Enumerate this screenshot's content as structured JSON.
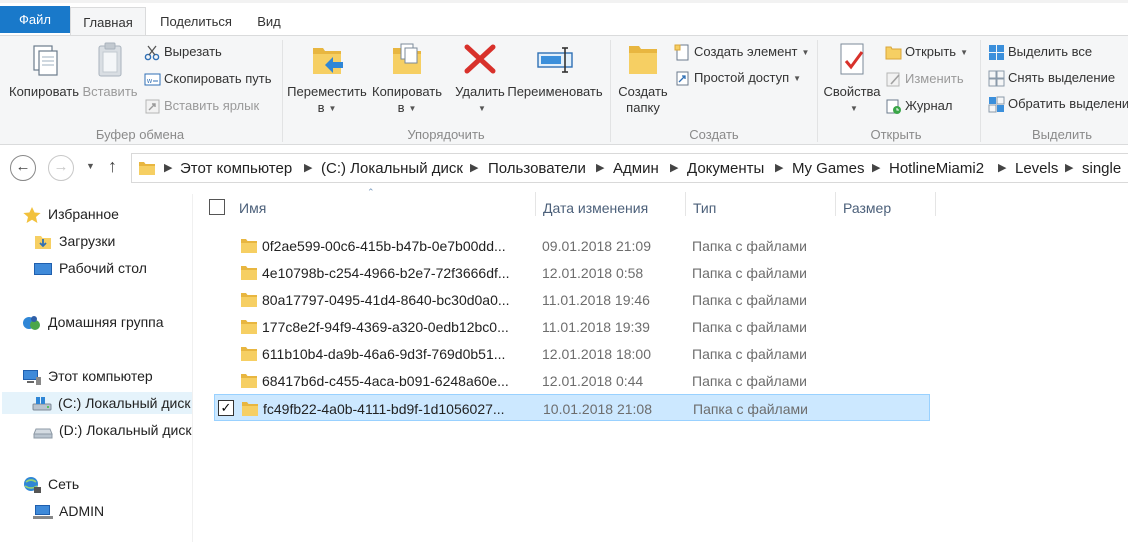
{
  "ribbon_tabs": [
    "Файл",
    "Главная",
    "Поделиться",
    "Вид"
  ],
  "clipboard": {
    "copy": "Копировать",
    "paste": "Вставить",
    "cut": "Вырезать",
    "copy_path": "Скопировать путь",
    "paste_shortcut": "Вставить ярлык",
    "label": "Буфер обмена"
  },
  "organize": {
    "move_line1": "Переместить",
    "move_line2": "в",
    "copy_line1": "Копировать",
    "copy_line2": "в",
    "delete": "Удалить",
    "rename": "Переименовать",
    "label": "Упорядочить"
  },
  "create": {
    "new_folder_line1": "Создать",
    "new_folder_line2": "папку",
    "new_item": "Создать элемент",
    "easy_access": "Простой доступ",
    "label": "Создать"
  },
  "open": {
    "properties": "Свойства",
    "open": "Открыть",
    "edit": "Изменить",
    "history": "Журнал",
    "label": "Открыть"
  },
  "select": {
    "select_all": "Выделить все",
    "select_none": "Снять выделение",
    "invert": "Обратить выделение",
    "label": "Выделить"
  },
  "address": {
    "crumbs": [
      "Этот компьютер",
      "(C:) Локальный диск",
      "Пользователи",
      "Админ",
      "Документы",
      "My Games",
      "HotlineMiami2",
      "Levels",
      "single"
    ]
  },
  "nav": {
    "favorites": "Избранное",
    "downloads": "Загрузки",
    "desktop": "Рабочий стол",
    "homegroup": "Домашняя группа",
    "this_pc": "Этот компьютер",
    "drive_c": "(C:) Локальный диск",
    "drive_d": "(D:) Локальный диск",
    "network": "Сеть",
    "admin": "ADMIN"
  },
  "columns": {
    "name": "Имя",
    "date": "Дата изменения",
    "type": "Тип",
    "size": "Размер"
  },
  "files": [
    {
      "name": "0f2ae599-00c6-415b-b47b-0e7b00dd...",
      "date": "09.01.2018 21:09",
      "type": "Папка с файлами"
    },
    {
      "name": "4e10798b-c254-4966-b2e7-72f3666df...",
      "date": "12.01.2018 0:58",
      "type": "Папка с файлами"
    },
    {
      "name": "80a17797-0495-41d4-8640-bc30d0a0...",
      "date": "11.01.2018 19:46",
      "type": "Папка с файлами"
    },
    {
      "name": "177c8e2f-94f9-4369-a320-0edb12bc0...",
      "date": "11.01.2018 19:39",
      "type": "Папка с файлами"
    },
    {
      "name": "611b10b4-da9b-46a6-9d3f-769d0b51...",
      "date": "12.01.2018 18:00",
      "type": "Папка с файлами"
    },
    {
      "name": "68417b6d-c455-4aca-b091-6248a60e...",
      "date": "12.01.2018 0:44",
      "type": "Папка с файлами"
    },
    {
      "name": "fc49fb22-4a0b-4111-bd9f-1d1056027...",
      "date": "10.01.2018 21:08",
      "type": "Папка с файлами",
      "selected": true
    }
  ],
  "colors": {
    "file_tab": "#1979ca",
    "selection_bg": "#cce8ff",
    "selection_border": "#99d1ff",
    "folder": "#f2c55c"
  }
}
